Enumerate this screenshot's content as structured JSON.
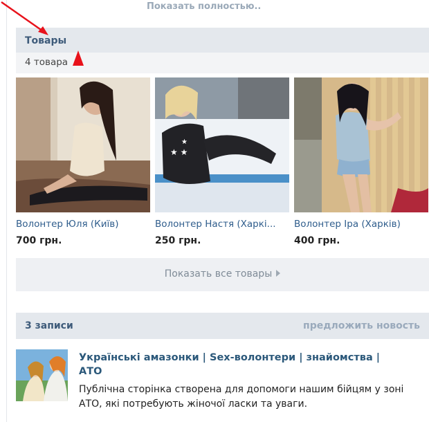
{
  "top_link": {
    "label": "Показать полностью.."
  },
  "goods": {
    "title": "Товары",
    "count": "4 товара",
    "items": [
      {
        "name": "Волонтер Юля (Київ)",
        "price": "700 грн."
      },
      {
        "name": "Волонтер Настя (Харкі...",
        "price": "250 грн."
      },
      {
        "name": "Волонтер Іра (Харків)",
        "price": "400 грн."
      }
    ],
    "show_all": "Показать все товары"
  },
  "posts": {
    "title": "3 записи",
    "suggest": "предложить новость",
    "item": {
      "title": "Українські амазонки | Sex-волонтери | знайомства | АТО",
      "text": "Публічна сторінка створена для допомоги нашим бійцям у зоні АТО, які потребують жіночої ласки та уваги."
    }
  },
  "colors": {
    "link": "#2f5d8c",
    "header_bg": "#e4e8ed",
    "annotation_red": "#e8121b"
  }
}
